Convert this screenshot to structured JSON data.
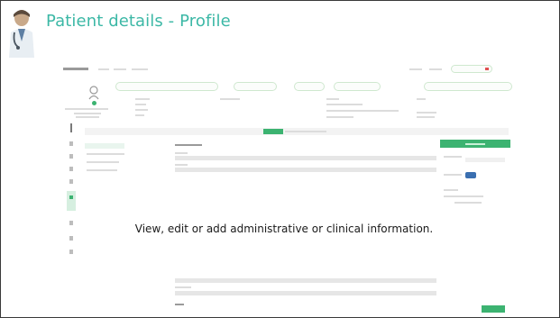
{
  "slide": {
    "title": "Patient details - Profile",
    "caption": "View, edit or add administrative or clinical information."
  },
  "icons": {
    "presenter": "doctor-icon",
    "profile_avatar": "patient-avatar-icon",
    "nav_rail": [
      "home-icon",
      "list-icon",
      "calendar-icon",
      "person-icon",
      "note-icon",
      "profile-icon",
      "document-icon",
      "chart-icon",
      "settings-icon"
    ]
  },
  "colors": {
    "title": "#3cb8a6",
    "accent_green": "#3cb371",
    "frame": "#3a3a3a"
  }
}
